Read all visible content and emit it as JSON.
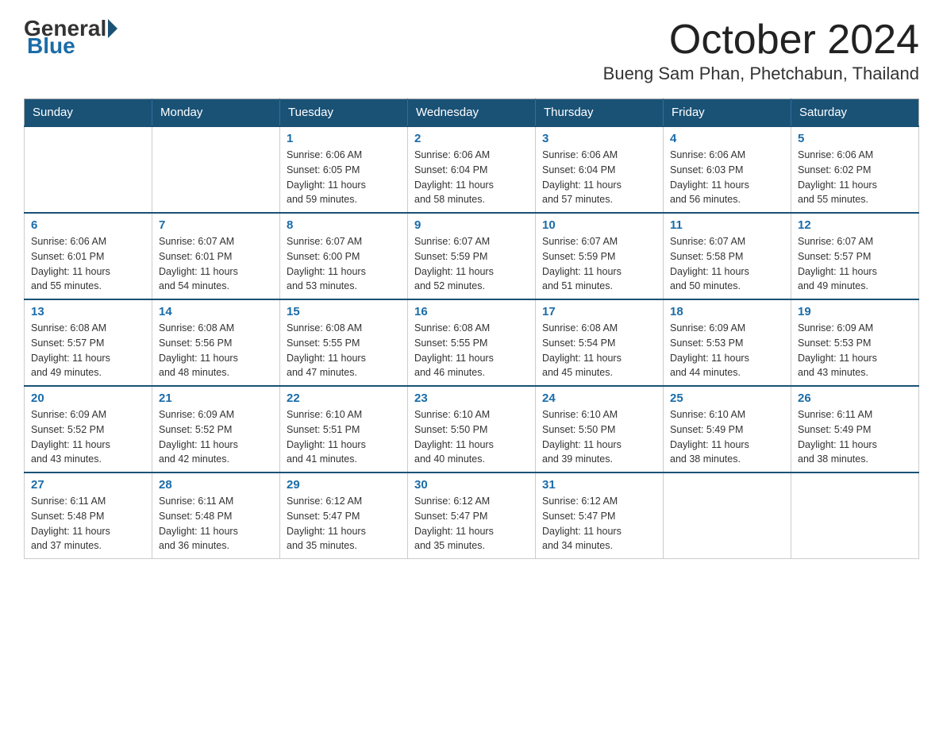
{
  "logo": {
    "general": "General",
    "blue": "Blue"
  },
  "title": "October 2024",
  "location": "Bueng Sam Phan, Phetchabun, Thailand",
  "headers": [
    "Sunday",
    "Monday",
    "Tuesday",
    "Wednesday",
    "Thursday",
    "Friday",
    "Saturday"
  ],
  "weeks": [
    [
      {
        "day": "",
        "info": ""
      },
      {
        "day": "",
        "info": ""
      },
      {
        "day": "1",
        "info": "Sunrise: 6:06 AM\nSunset: 6:05 PM\nDaylight: 11 hours\nand 59 minutes."
      },
      {
        "day": "2",
        "info": "Sunrise: 6:06 AM\nSunset: 6:04 PM\nDaylight: 11 hours\nand 58 minutes."
      },
      {
        "day": "3",
        "info": "Sunrise: 6:06 AM\nSunset: 6:04 PM\nDaylight: 11 hours\nand 57 minutes."
      },
      {
        "day": "4",
        "info": "Sunrise: 6:06 AM\nSunset: 6:03 PM\nDaylight: 11 hours\nand 56 minutes."
      },
      {
        "day": "5",
        "info": "Sunrise: 6:06 AM\nSunset: 6:02 PM\nDaylight: 11 hours\nand 55 minutes."
      }
    ],
    [
      {
        "day": "6",
        "info": "Sunrise: 6:06 AM\nSunset: 6:01 PM\nDaylight: 11 hours\nand 55 minutes."
      },
      {
        "day": "7",
        "info": "Sunrise: 6:07 AM\nSunset: 6:01 PM\nDaylight: 11 hours\nand 54 minutes."
      },
      {
        "day": "8",
        "info": "Sunrise: 6:07 AM\nSunset: 6:00 PM\nDaylight: 11 hours\nand 53 minutes."
      },
      {
        "day": "9",
        "info": "Sunrise: 6:07 AM\nSunset: 5:59 PM\nDaylight: 11 hours\nand 52 minutes."
      },
      {
        "day": "10",
        "info": "Sunrise: 6:07 AM\nSunset: 5:59 PM\nDaylight: 11 hours\nand 51 minutes."
      },
      {
        "day": "11",
        "info": "Sunrise: 6:07 AM\nSunset: 5:58 PM\nDaylight: 11 hours\nand 50 minutes."
      },
      {
        "day": "12",
        "info": "Sunrise: 6:07 AM\nSunset: 5:57 PM\nDaylight: 11 hours\nand 49 minutes."
      }
    ],
    [
      {
        "day": "13",
        "info": "Sunrise: 6:08 AM\nSunset: 5:57 PM\nDaylight: 11 hours\nand 49 minutes."
      },
      {
        "day": "14",
        "info": "Sunrise: 6:08 AM\nSunset: 5:56 PM\nDaylight: 11 hours\nand 48 minutes."
      },
      {
        "day": "15",
        "info": "Sunrise: 6:08 AM\nSunset: 5:55 PM\nDaylight: 11 hours\nand 47 minutes."
      },
      {
        "day": "16",
        "info": "Sunrise: 6:08 AM\nSunset: 5:55 PM\nDaylight: 11 hours\nand 46 minutes."
      },
      {
        "day": "17",
        "info": "Sunrise: 6:08 AM\nSunset: 5:54 PM\nDaylight: 11 hours\nand 45 minutes."
      },
      {
        "day": "18",
        "info": "Sunrise: 6:09 AM\nSunset: 5:53 PM\nDaylight: 11 hours\nand 44 minutes."
      },
      {
        "day": "19",
        "info": "Sunrise: 6:09 AM\nSunset: 5:53 PM\nDaylight: 11 hours\nand 43 minutes."
      }
    ],
    [
      {
        "day": "20",
        "info": "Sunrise: 6:09 AM\nSunset: 5:52 PM\nDaylight: 11 hours\nand 43 minutes."
      },
      {
        "day": "21",
        "info": "Sunrise: 6:09 AM\nSunset: 5:52 PM\nDaylight: 11 hours\nand 42 minutes."
      },
      {
        "day": "22",
        "info": "Sunrise: 6:10 AM\nSunset: 5:51 PM\nDaylight: 11 hours\nand 41 minutes."
      },
      {
        "day": "23",
        "info": "Sunrise: 6:10 AM\nSunset: 5:50 PM\nDaylight: 11 hours\nand 40 minutes."
      },
      {
        "day": "24",
        "info": "Sunrise: 6:10 AM\nSunset: 5:50 PM\nDaylight: 11 hours\nand 39 minutes."
      },
      {
        "day": "25",
        "info": "Sunrise: 6:10 AM\nSunset: 5:49 PM\nDaylight: 11 hours\nand 38 minutes."
      },
      {
        "day": "26",
        "info": "Sunrise: 6:11 AM\nSunset: 5:49 PM\nDaylight: 11 hours\nand 38 minutes."
      }
    ],
    [
      {
        "day": "27",
        "info": "Sunrise: 6:11 AM\nSunset: 5:48 PM\nDaylight: 11 hours\nand 37 minutes."
      },
      {
        "day": "28",
        "info": "Sunrise: 6:11 AM\nSunset: 5:48 PM\nDaylight: 11 hours\nand 36 minutes."
      },
      {
        "day": "29",
        "info": "Sunrise: 6:12 AM\nSunset: 5:47 PM\nDaylight: 11 hours\nand 35 minutes."
      },
      {
        "day": "30",
        "info": "Sunrise: 6:12 AM\nSunset: 5:47 PM\nDaylight: 11 hours\nand 35 minutes."
      },
      {
        "day": "31",
        "info": "Sunrise: 6:12 AM\nSunset: 5:47 PM\nDaylight: 11 hours\nand 34 minutes."
      },
      {
        "day": "",
        "info": ""
      },
      {
        "day": "",
        "info": ""
      }
    ]
  ]
}
